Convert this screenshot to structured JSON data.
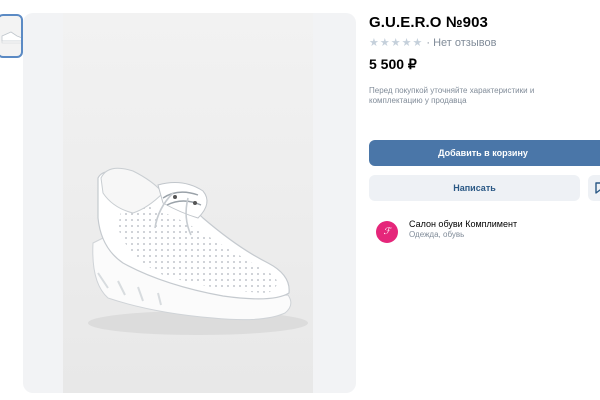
{
  "product": {
    "title": "G.U.E.R.O №903",
    "rating_text": "· Нет отзывов",
    "price": "5 500 ₽",
    "note": "Перед покупкой уточняйте характеристики и комплектацию у продавца"
  },
  "actions": {
    "add_to_cart": "Добавить в корзину",
    "message": "Написать"
  },
  "seller": {
    "name": "Салон обуви Комплимент",
    "category": "Одежда, обувь"
  },
  "icons": {
    "star": "★",
    "rating": "star-icon",
    "bookmark": "bookmark-icon"
  },
  "colors": {
    "primary_button": "#4a76a8",
    "secondary_button": "#eef1f5",
    "link": "#2a5885",
    "muted_text": "#818c99",
    "avatar": "#e5267a"
  }
}
